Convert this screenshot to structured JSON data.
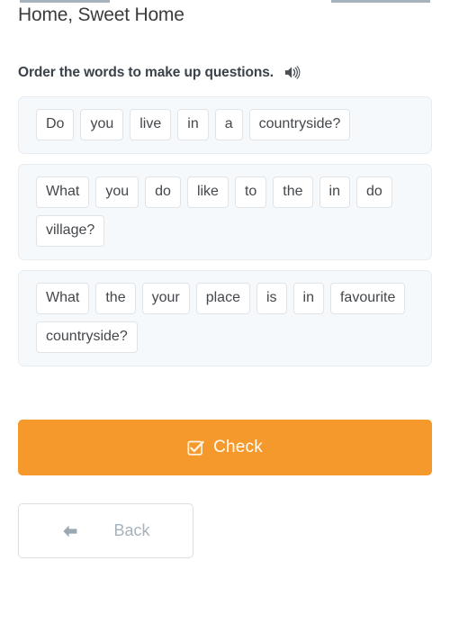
{
  "header": {
    "title": "Home, Sweet Home"
  },
  "exercise": {
    "instruction": "Order the words to make up questions.",
    "audio_icon": "speaker-icon",
    "blocks": [
      {
        "id": "question-1",
        "words": [
          "Do",
          "you",
          "live",
          "in",
          "a",
          "countryside?"
        ]
      },
      {
        "id": "question-2",
        "words": [
          "What",
          "you",
          "do",
          "like",
          "to",
          "the",
          "in",
          "do",
          "village?"
        ]
      },
      {
        "id": "question-3",
        "words": [
          "What",
          "the",
          "your",
          "place",
          "is",
          "in",
          "favourite",
          "countryside?"
        ]
      }
    ]
  },
  "footer": {
    "check_label": "Check",
    "check_icon": "checked-box-icon",
    "back_label": "Back",
    "back_icon": "arrow-left-icon"
  },
  "colors": {
    "accent_orange": "#f5992c",
    "panel_background": "#f5f9fc",
    "chip_border": "#dfe4e8",
    "text_dark": "#3a4149",
    "text_muted": "#a6b2bb"
  }
}
